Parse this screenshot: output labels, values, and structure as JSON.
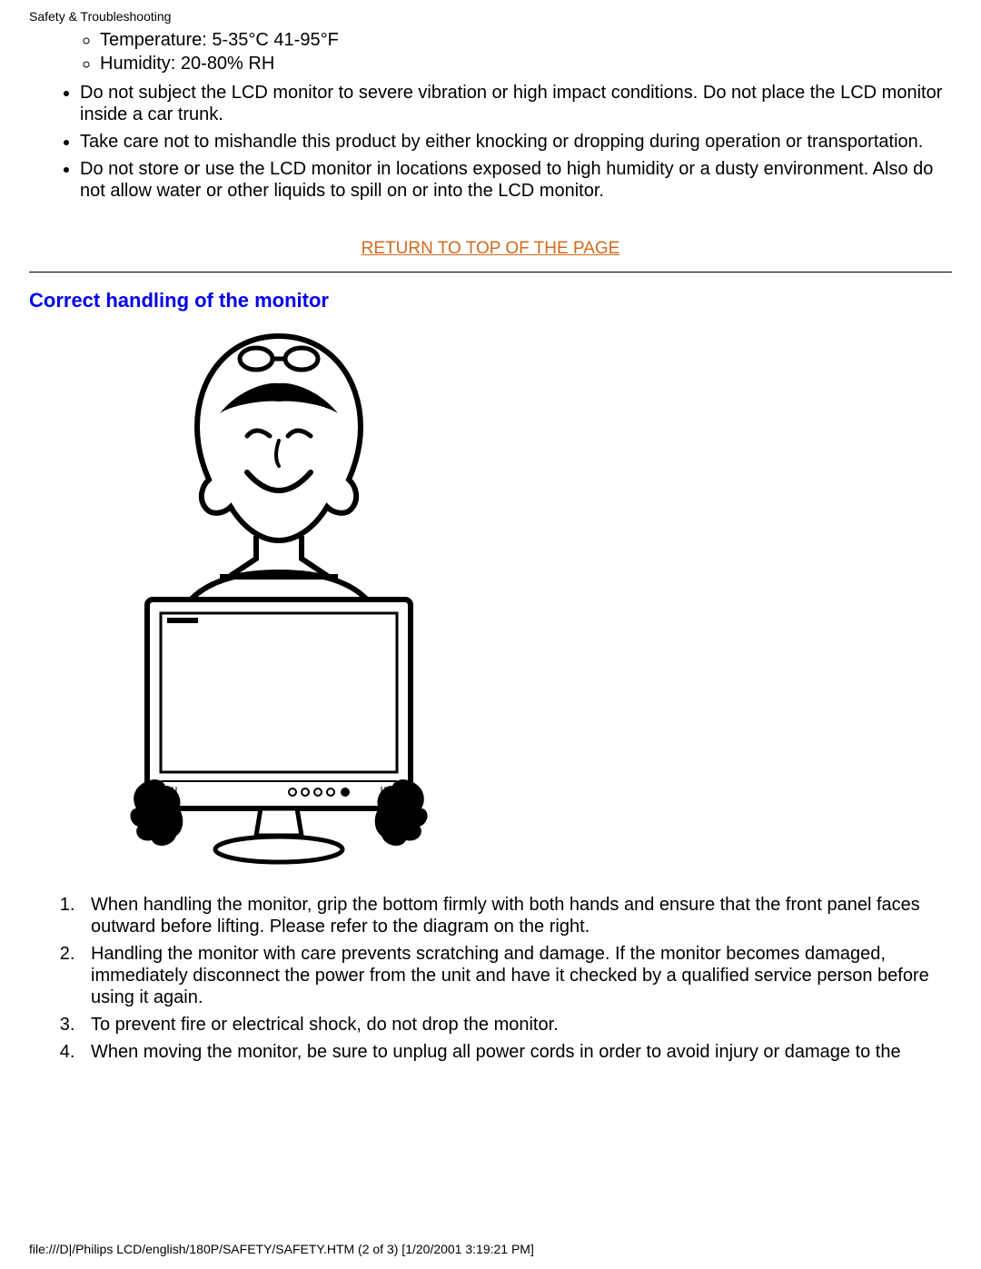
{
  "header_title": "Safety & Troubleshooting",
  "env_spec": {
    "temperature": "Temperature: 5-35°C 41-95°F",
    "humidity": "Humidity: 20-80% RH"
  },
  "bullets": [
    "Do not subject the LCD monitor to severe vibration or high impact conditions. Do not place the LCD monitor inside a car trunk.",
    "Take care not to mishandle this product by either knocking or dropping during operation or transportation.",
    "Do not store or use the LCD monitor in locations exposed to high humidity or a dusty environment. Also do not allow water or other liquids to spill on or into the LCD monitor."
  ],
  "return_link_label": "RETURN TO TOP OF THE PAGE",
  "section_title": "Correct handling of the monitor",
  "illustration_alt": "Person holding an LCD monitor from below with both hands, front facing outward",
  "handling_steps": [
    "When handling the monitor, grip the bottom firmly with both hands and ensure that the front panel faces outward before lifting. Please refer to the diagram on the right.",
    "Handling the monitor with care prevents scratching and damage. If the monitor becomes damaged, immediately disconnect the power from the unit and have it checked by a qualified service person before using it again.",
    "To prevent fire or electrical shock, do not drop the monitor.",
    "When moving the monitor, be sure to unplug all power cords in order to avoid injury or damage to the"
  ],
  "footer_text": "file:///D|/Philips LCD/english/180P/SAFETY/SAFETY.HTM (2 of 3) [1/20/2001 3:19:21 PM]"
}
